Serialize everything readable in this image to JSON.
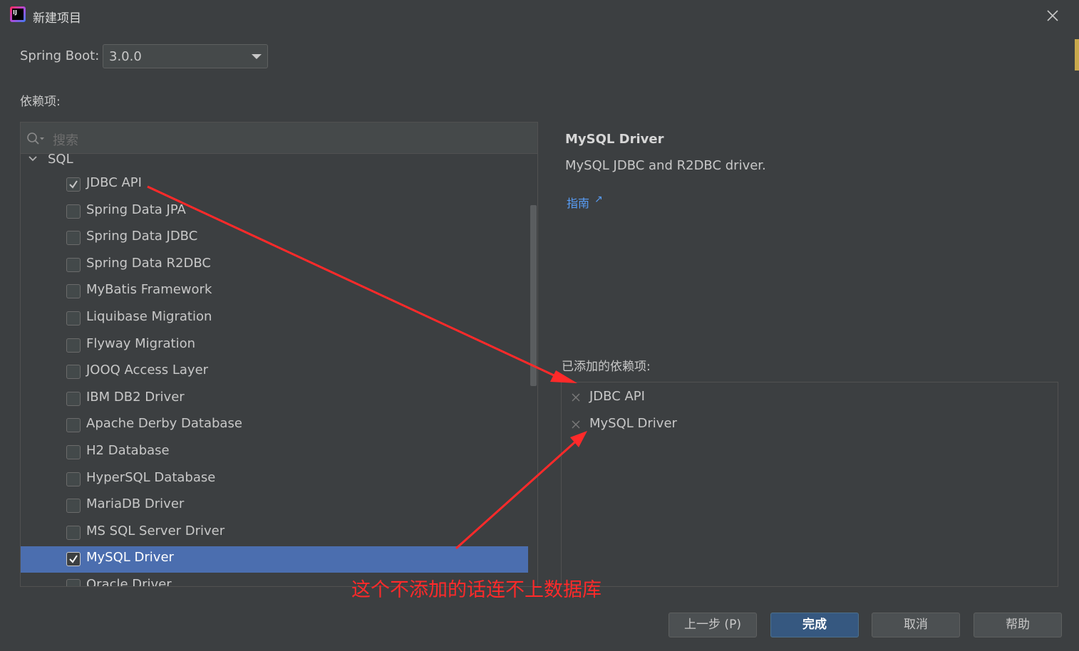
{
  "window": {
    "title": "新建项目"
  },
  "spring_boot": {
    "label": "Spring Boot:",
    "value": "3.0.0"
  },
  "dependencies": {
    "label": "依赖项:",
    "search_placeholder": "搜索",
    "group": "SQL",
    "items": [
      {
        "label": "JDBC API",
        "checked": true
      },
      {
        "label": "Spring Data JPA",
        "checked": false
      },
      {
        "label": "Spring Data JDBC",
        "checked": false
      },
      {
        "label": "Spring Data R2DBC",
        "checked": false
      },
      {
        "label": "MyBatis Framework",
        "checked": false
      },
      {
        "label": "Liquibase Migration",
        "checked": false
      },
      {
        "label": "Flyway Migration",
        "checked": false
      },
      {
        "label": "JOOQ Access Layer",
        "checked": false
      },
      {
        "label": "IBM DB2 Driver",
        "checked": false
      },
      {
        "label": "Apache Derby Database",
        "checked": false
      },
      {
        "label": "H2 Database",
        "checked": false
      },
      {
        "label": "HyperSQL Database",
        "checked": false
      },
      {
        "label": "MariaDB Driver",
        "checked": false
      },
      {
        "label": "MS SQL Server Driver",
        "checked": false
      },
      {
        "label": "MySQL Driver",
        "checked": true,
        "selected": true
      },
      {
        "label": "Oracle Driver",
        "checked": false
      }
    ]
  },
  "detail": {
    "title": "MySQL Driver",
    "description": "MySQL JDBC and R2DBC driver.",
    "guide_link": "指南"
  },
  "added": {
    "label": "已添加的依赖项:",
    "items": [
      "JDBC API",
      "MySQL Driver"
    ]
  },
  "annotation": {
    "text": "这个不添加的话连不上数据库",
    "color": "#ff2a2a"
  },
  "buttons": {
    "prev": "上一步 (P)",
    "finish": "完成",
    "cancel": "取消",
    "help": "帮助"
  },
  "colors": {
    "background": "#3c3f41",
    "selection": "#4b6eaf",
    "link": "#589df6",
    "primary_button": "#365880"
  }
}
